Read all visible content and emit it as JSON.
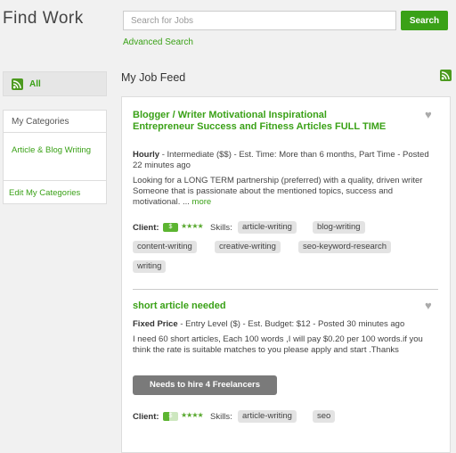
{
  "header": {
    "title": "Find Work",
    "search_placeholder": "Search for Jobs",
    "search_button": "Search",
    "advanced_search": "Advanced Search"
  },
  "sidebar": {
    "all_label": "All",
    "categories_heading": "My Categories",
    "categories": [
      "Article & Blog Writing"
    ],
    "edit_categories": "Edit My Categories"
  },
  "feed": {
    "title": "My Job Feed",
    "jobs": [
      {
        "title": "Blogger / Writer Motivational Inspirational Entrepreneur Success and Fitness Articles FULL TIME",
        "type": "Hourly",
        "meta": " - Intermediate ($$) - Est. Time: More than 6 months, Part Time - Posted 22 minutes ago",
        "description": "Looking for a LONG TERM partnership (preferred) with a quality, driven writer Someone that is passionate about the mentioned topics, success and motivational. ... ",
        "more": "more",
        "client_label": "Client:",
        "payment_icon": "$",
        "rating_stars": "★★★★",
        "skills_label": "Skills:",
        "skills": [
          "article-writing",
          "blog-writing",
          "content-writing",
          "creative-writing",
          "seo-keyword-research",
          "writing"
        ]
      },
      {
        "title": "short article needed",
        "type": "Fixed Price",
        "meta": " - Entry Level ($) - Est. Budget: $12 - Posted 30 minutes ago",
        "description": "I need 60 short articles, Each 100 words ,I will pay $0.20 per 100 words.if you think the rate is suitable matches to you please apply and start .Thanks",
        "hire_note": "Needs to hire 4 Freelancers",
        "client_label": "Client:",
        "payment_icon": "$",
        "rating_stars": "★★★★",
        "skills_label": "Skills:",
        "skills": [
          "article-writing",
          "seo"
        ]
      }
    ]
  },
  "colors": {
    "accent": "#3aa117",
    "button_gray": "#7a7a7a",
    "tag_bg": "#e3e3e3"
  },
  "icons": [
    "rss-icon",
    "heart-icon",
    "payment-verified-icon",
    "star-rating-icon"
  ]
}
